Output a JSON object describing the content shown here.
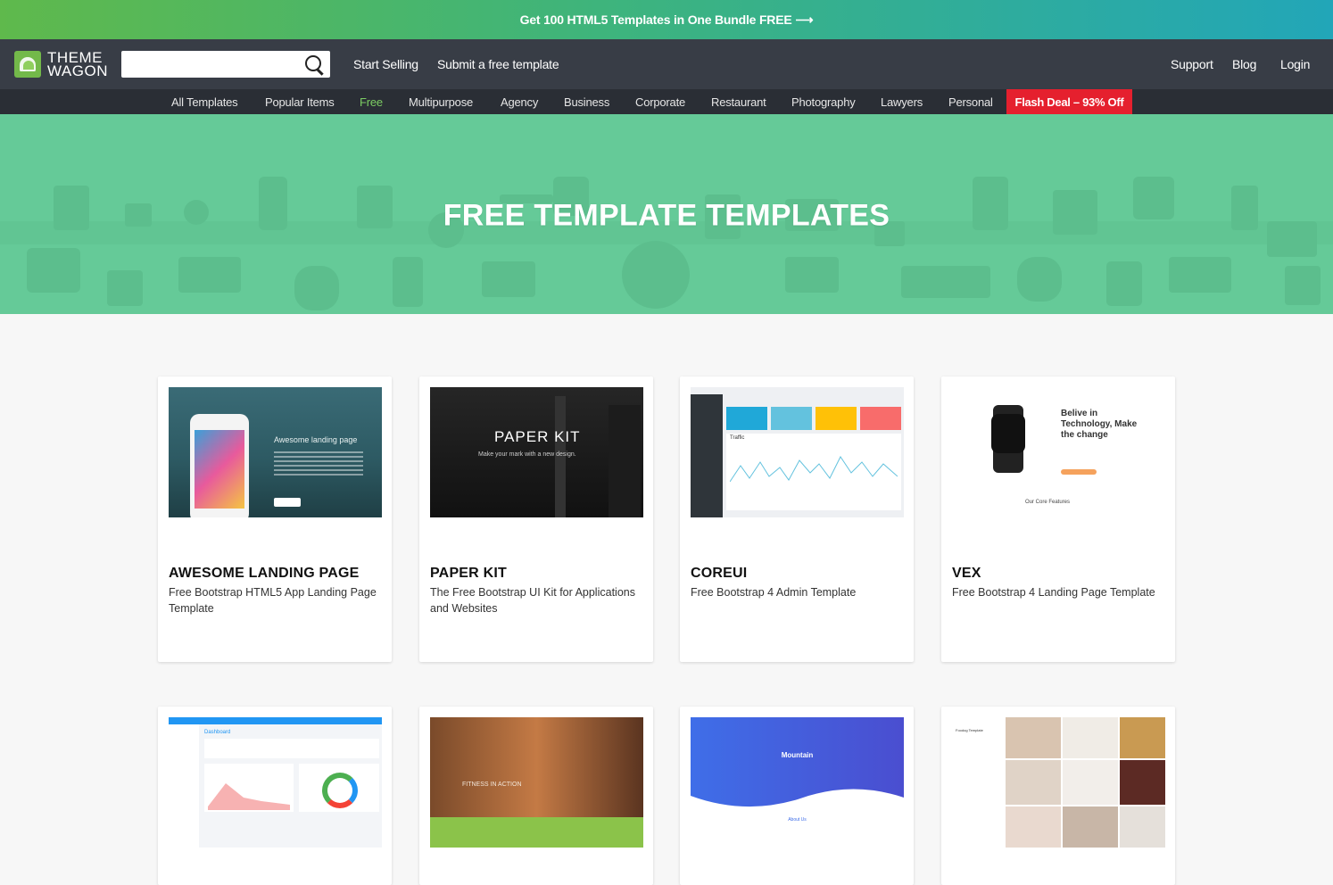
{
  "promo": {
    "text": "Get 100 HTML5 Templates in One Bundle FREE",
    "arrow": "⟶"
  },
  "header": {
    "logo_line1": "THEME",
    "logo_line2": "WAGON",
    "search_placeholder": "",
    "links_left": [
      "Start Selling",
      "Submit a free template"
    ],
    "links_right": [
      "Support",
      "Blog",
      "Login"
    ]
  },
  "categories": [
    "All Templates",
    "Popular Items",
    "Free",
    "Multipurpose",
    "Agency",
    "Business",
    "Corporate",
    "Restaurant",
    "Photography",
    "Lawyers",
    "Personal"
  ],
  "active_category": "Free",
  "flash_deal": "Flash Deal – 93% Off",
  "hero": {
    "title": "FREE TEMPLATE TEMPLATES"
  },
  "cards": [
    {
      "title": "AWESOME LANDING PAGE",
      "description": "Free Bootstrap HTML5 App Landing Page Template",
      "thumb_text": "Awesome landing page"
    },
    {
      "title": "PAPER KIT",
      "description": "The Free Bootstrap UI Kit for Applications and Websites",
      "thumb_text": "PAPER KIT",
      "thumb_sub": "Make your mark with a new design."
    },
    {
      "title": "COREUI",
      "description": "Free Bootstrap 4 Admin Template",
      "thumb_text": "Traffic"
    },
    {
      "title": "VEX",
      "description": "Free Bootstrap 4 Landing Page Template",
      "thumb_text": "Belive in Technology, Make the change",
      "thumb_sub": "Our Core Features"
    },
    {
      "title": "",
      "description": "",
      "thumb_text": "Dashboard"
    },
    {
      "title": "",
      "description": "",
      "thumb_text": "FITNESS IN ACTION"
    },
    {
      "title": "",
      "description": "",
      "thumb_text": "Mountain",
      "thumb_sub": "About Us"
    },
    {
      "title": "",
      "description": "",
      "thumb_text": "Foodog Template"
    }
  ],
  "colors": {
    "promo_start": "#5fb94c",
    "promo_end": "#22a6b8",
    "header_bg": "#383d46",
    "nav_bg": "#2a2e35",
    "active": "#7ccc63",
    "flash": "#e5202e",
    "hero": "#65ca98"
  }
}
